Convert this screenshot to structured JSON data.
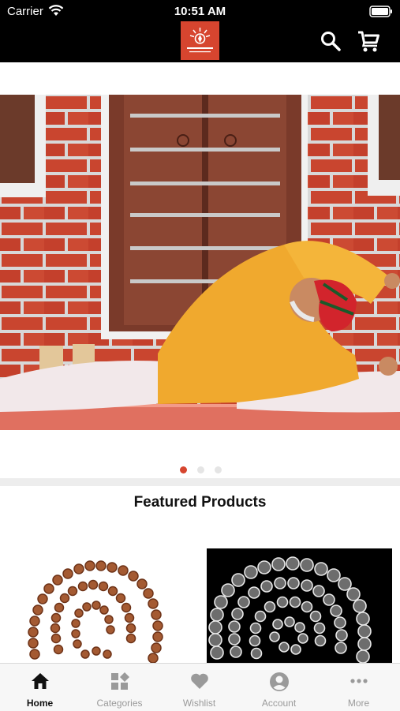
{
  "status_bar": {
    "carrier": "Carrier",
    "time": "10:51 AM"
  },
  "header": {
    "logo_icon": "brand-logo",
    "search_icon": "search-icon",
    "cart_icon": "cart-icon"
  },
  "carousel": {
    "slide_count": 3,
    "active_index": 0
  },
  "featured": {
    "title": "Featured Products"
  },
  "products": [
    {
      "image": "rudraksha-mala"
    },
    {
      "image": "crystal-mala"
    }
  ],
  "tabs": [
    {
      "label": "Home",
      "icon": "home-icon",
      "active": true
    },
    {
      "label": "Categories",
      "icon": "categories-icon",
      "active": false
    },
    {
      "label": "Wishlist",
      "icon": "heart-icon",
      "active": false
    },
    {
      "label": "Account",
      "icon": "account-icon",
      "active": false
    },
    {
      "label": "More",
      "icon": "more-icon",
      "active": false
    }
  ],
  "colors": {
    "accent": "#d6452f",
    "header_bg": "#000000",
    "tab_inactive": "#9a9a9a",
    "tab_active": "#111111"
  }
}
